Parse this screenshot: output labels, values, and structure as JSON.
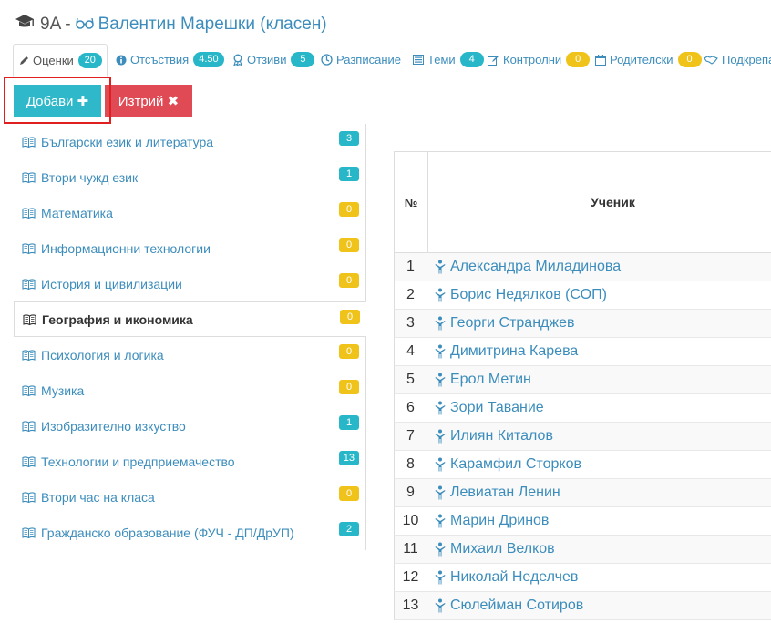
{
  "header": {
    "class_label": "9А",
    "separator": "-",
    "teacher": "Валентин Марешки (класен)"
  },
  "tabs": [
    {
      "label": "Оценки",
      "badge": "20",
      "badge_color": "teal",
      "icon": "pencil-icon",
      "active": true
    },
    {
      "label": "Отсъствия",
      "badge": "4.50",
      "badge_color": "teal",
      "icon": "info-icon"
    },
    {
      "label": "Отзиви",
      "badge": "5",
      "badge_color": "teal",
      "icon": "award-icon"
    },
    {
      "label": "Разписание",
      "badge": "",
      "icon": "clock-icon"
    },
    {
      "label": "Теми",
      "badge": "4",
      "badge_color": "teal",
      "icon": "list-icon"
    },
    {
      "label": "Контролни",
      "badge": "0",
      "badge_color": "yellow",
      "icon": "edit-icon"
    },
    {
      "label": "Родителски",
      "badge": "0",
      "badge_color": "yellow",
      "icon": "calendar-icon"
    },
    {
      "label": "Подкрепа",
      "badge": "",
      "icon": "handshake-icon"
    }
  ],
  "buttons": {
    "add_label": "Добави",
    "add_symbol": "✚",
    "delete_label": "Изтрий",
    "delete_symbol": "✖"
  },
  "colors": {
    "link": "#3c8dbc",
    "teal": "#27b7c9",
    "yellow": "#f0c31b",
    "danger": "#e04a55",
    "highlight": "#e02020"
  },
  "subjects": [
    {
      "name": "Български език и литература",
      "count": "3",
      "color": "teal"
    },
    {
      "name": "Втори чужд език",
      "count": "1",
      "color": "teal"
    },
    {
      "name": "Математика",
      "count": "0",
      "color": "yellow"
    },
    {
      "name": "Информационни технологии",
      "count": "0",
      "color": "yellow"
    },
    {
      "name": "История и цивилизации",
      "count": "0",
      "color": "yellow"
    },
    {
      "name": "География и икономика",
      "count": "0",
      "color": "yellow",
      "active": true
    },
    {
      "name": "Психология и логика",
      "count": "0",
      "color": "yellow"
    },
    {
      "name": "Музика",
      "count": "0",
      "color": "yellow"
    },
    {
      "name": "Изобразително изкуство",
      "count": "1",
      "color": "teal"
    },
    {
      "name": "Технологии и предприемачество",
      "count": "13",
      "color": "teal"
    },
    {
      "name": "Втори час на класа",
      "count": "0",
      "color": "yellow"
    },
    {
      "name": "Гражданско образование (ФУЧ - ДП/ДрУП)",
      "count": "2",
      "color": "teal"
    }
  ],
  "table": {
    "col_no": "№",
    "col_student": "Ученик",
    "students": [
      {
        "no": "1",
        "name": "Александра Миладинова"
      },
      {
        "no": "2",
        "name": "Борис Недялков (СОП)"
      },
      {
        "no": "3",
        "name": "Георги Странджев"
      },
      {
        "no": "4",
        "name": "Димитрина Карева"
      },
      {
        "no": "5",
        "name": "Ерол Метин"
      },
      {
        "no": "6",
        "name": "Зори Тавание"
      },
      {
        "no": "7",
        "name": "Илиян Киталов"
      },
      {
        "no": "8",
        "name": "Карамфил Сторков"
      },
      {
        "no": "9",
        "name": "Левиатан Ленин"
      },
      {
        "no": "10",
        "name": "Марин Дринов"
      },
      {
        "no": "11",
        "name": "Михаил Велков"
      },
      {
        "no": "12",
        "name": "Николай Неделчев"
      },
      {
        "no": "13",
        "name": "Сюлейман Сотиров"
      }
    ]
  }
}
